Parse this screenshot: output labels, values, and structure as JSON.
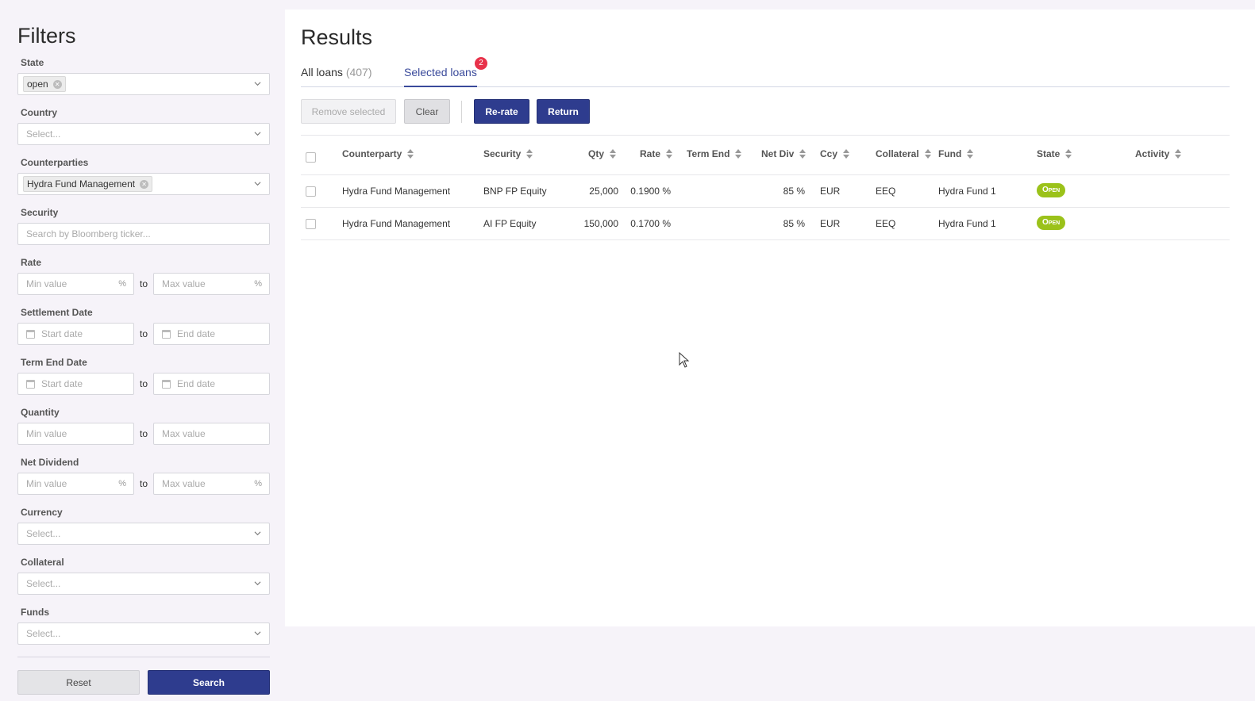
{
  "filters": {
    "title": "Filters",
    "state": {
      "label": "State",
      "tag": "open"
    },
    "country": {
      "label": "Country",
      "placeholder": "Select..."
    },
    "counterparties": {
      "label": "Counterparties",
      "tag": "Hydra Fund Management"
    },
    "security": {
      "label": "Security",
      "placeholder": "Search by Bloomberg ticker..."
    },
    "rate": {
      "label": "Rate",
      "min_placeholder": "Min value",
      "max_placeholder": "Max value",
      "suffix": "%"
    },
    "settlement_date": {
      "label": "Settlement Date",
      "start_placeholder": "Start date",
      "end_placeholder": "End date"
    },
    "term_end_date": {
      "label": "Term End Date",
      "start_placeholder": "Start date",
      "end_placeholder": "End date"
    },
    "quantity": {
      "label": "Quantity",
      "min_placeholder": "Min value",
      "max_placeholder": "Max value"
    },
    "net_dividend": {
      "label": "Net Dividend",
      "min_placeholder": "Min value",
      "max_placeholder": "Max value",
      "suffix": "%"
    },
    "currency": {
      "label": "Currency",
      "placeholder": "Select..."
    },
    "collateral": {
      "label": "Collateral",
      "placeholder": "Select..."
    },
    "funds": {
      "label": "Funds",
      "placeholder": "Select..."
    },
    "to_label": "to",
    "reset_label": "Reset",
    "search_label": "Search"
  },
  "results": {
    "title": "Results",
    "tabs": {
      "all_label": "All loans",
      "all_count": "(407)",
      "selected_label": "Selected loans",
      "selected_badge": "2"
    },
    "toolbar": {
      "remove_label": "Remove selected",
      "clear_label": "Clear",
      "rerate_label": "Re-rate",
      "return_label": "Return"
    },
    "columns": [
      "Counterparty",
      "Security",
      "Qty",
      "Rate",
      "Term End",
      "Net Div",
      "Ccy",
      "Collateral",
      "Fund",
      "State",
      "Activity"
    ],
    "rows": [
      {
        "counterparty": "Hydra Fund Management",
        "security": "BNP FP Equity",
        "qty": "25,000",
        "rate": "0.1900 %",
        "term_end": "",
        "net_div": "85 %",
        "ccy": "EUR",
        "collateral": "EEQ",
        "fund": "Hydra Fund 1",
        "state": "Open",
        "activity": ""
      },
      {
        "counterparty": "Hydra Fund Management",
        "security": "AI FP Equity",
        "qty": "150,000",
        "rate": "0.1700 %",
        "term_end": "",
        "net_div": "85 %",
        "ccy": "EUR",
        "collateral": "EEQ",
        "fund": "Hydra Fund 1",
        "state": "Open",
        "activity": ""
      }
    ]
  },
  "colors": {
    "primary": "#2e3c8e",
    "badge": "#e8324a",
    "open_state": "#9bc21a",
    "background": "#f6f3f9"
  }
}
